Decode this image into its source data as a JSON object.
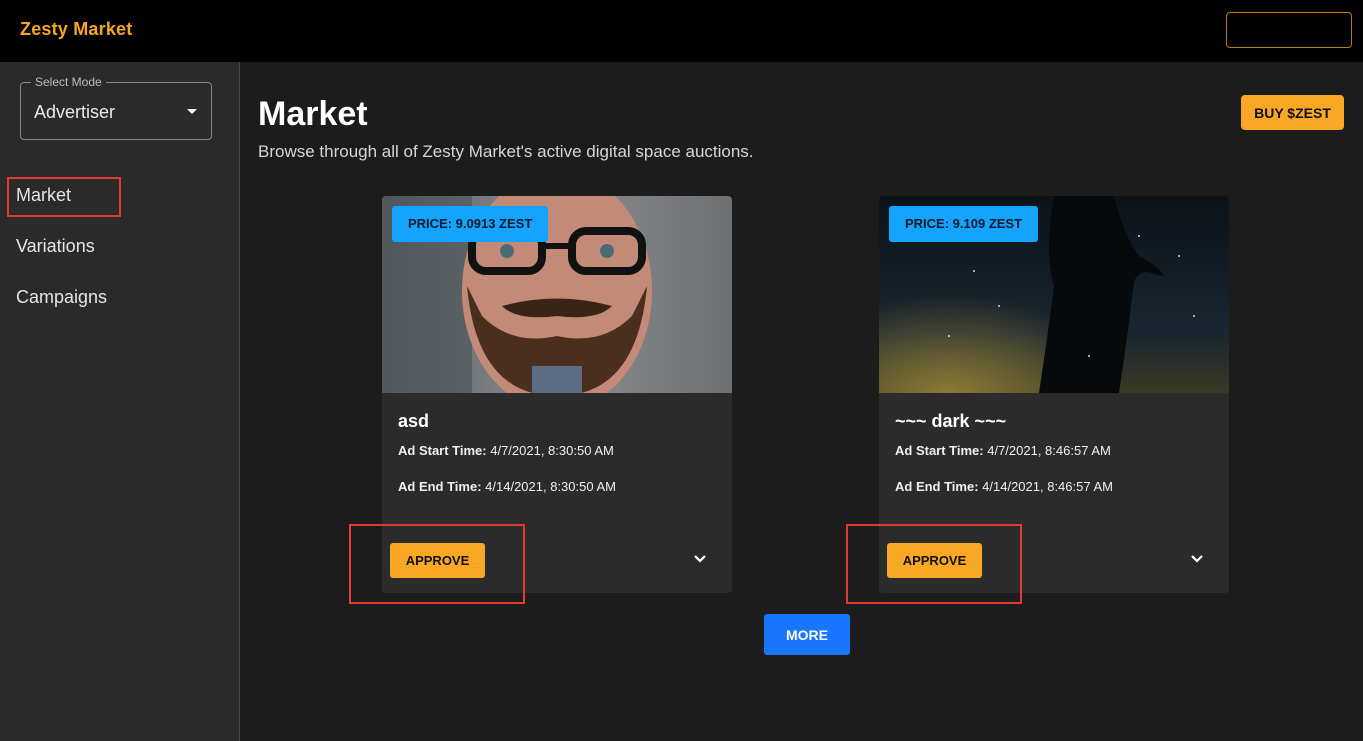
{
  "app": {
    "brand": "Zesty Market"
  },
  "sidebar": {
    "mode_label": "Select Mode",
    "mode_value": "Advertiser",
    "items": [
      {
        "label": "Market"
      },
      {
        "label": "Variations"
      },
      {
        "label": "Campaigns"
      }
    ]
  },
  "page": {
    "title": "Market",
    "subtitle": "Browse through all of Zesty Market's active digital space auctions.",
    "buy_label": "BUY $ZEST",
    "more_label": "MORE"
  },
  "cards": [
    {
      "price": "PRICE: 9.0913 ZEST",
      "title": "asd",
      "start_label": "Ad Start Time:",
      "start_value": " 4/7/2021, 8:30:50 AM",
      "end_label": "Ad End Time:",
      "end_value": " 4/14/2021, 8:30:50 AM",
      "action": "APPROVE"
    },
    {
      "price": "PRICE: 9.109 ZEST",
      "title": "~~~ dark ~~~",
      "start_label": "Ad Start Time:",
      "start_value": " 4/7/2021, 8:46:57 AM",
      "end_label": "Ad End Time:",
      "end_value": " 4/14/2021, 8:46:57 AM",
      "action": "APPROVE"
    }
  ],
  "colors": {
    "brand": "#f5a623",
    "accent_button": "#f9a825",
    "price_badge": "#14a3ff",
    "more_button": "#1976ff",
    "highlight": "#e53935"
  }
}
